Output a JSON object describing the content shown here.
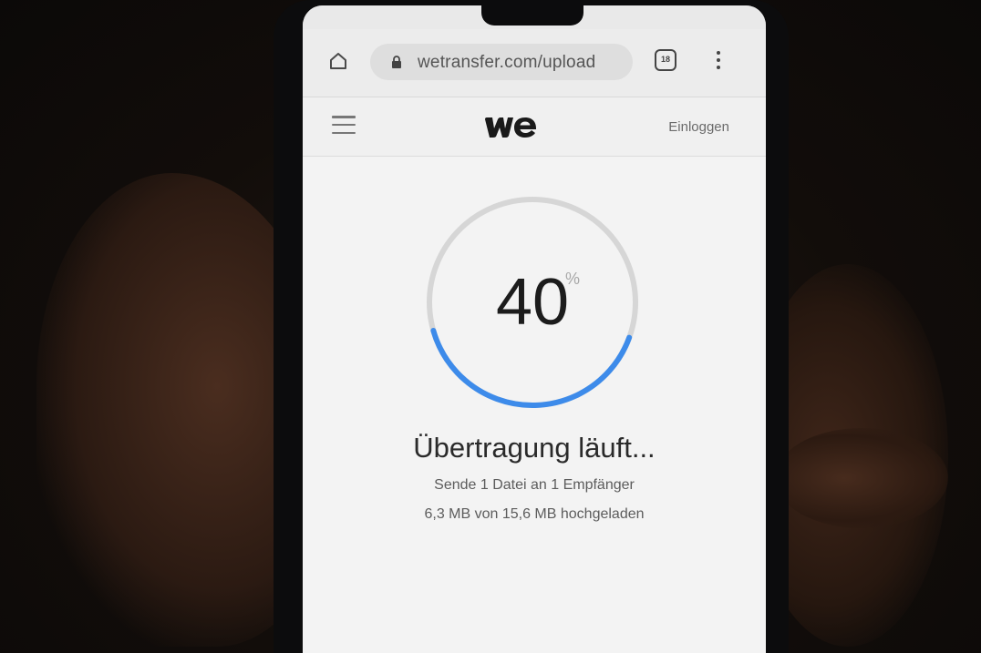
{
  "browser": {
    "url": "wetransfer.com/upload",
    "tab_count": "18"
  },
  "site": {
    "login_label": "Einloggen"
  },
  "upload": {
    "percent": "40",
    "percent_sign": "%",
    "progress_fraction": 0.4,
    "title": "Übertragung läuft...",
    "recipients_line": "Sende 1 Datei an 1 Empfänger",
    "size_line": "6,3 MB von 15,6 MB hochgeladen"
  },
  "colors": {
    "progress_accent": "#3d8bea",
    "progress_track": "#d6d6d6"
  },
  "icons": [
    "home-icon",
    "lock-icon",
    "tabs-icon",
    "more-vert-icon",
    "hamburger-menu-icon",
    "wetransfer-logo"
  ]
}
